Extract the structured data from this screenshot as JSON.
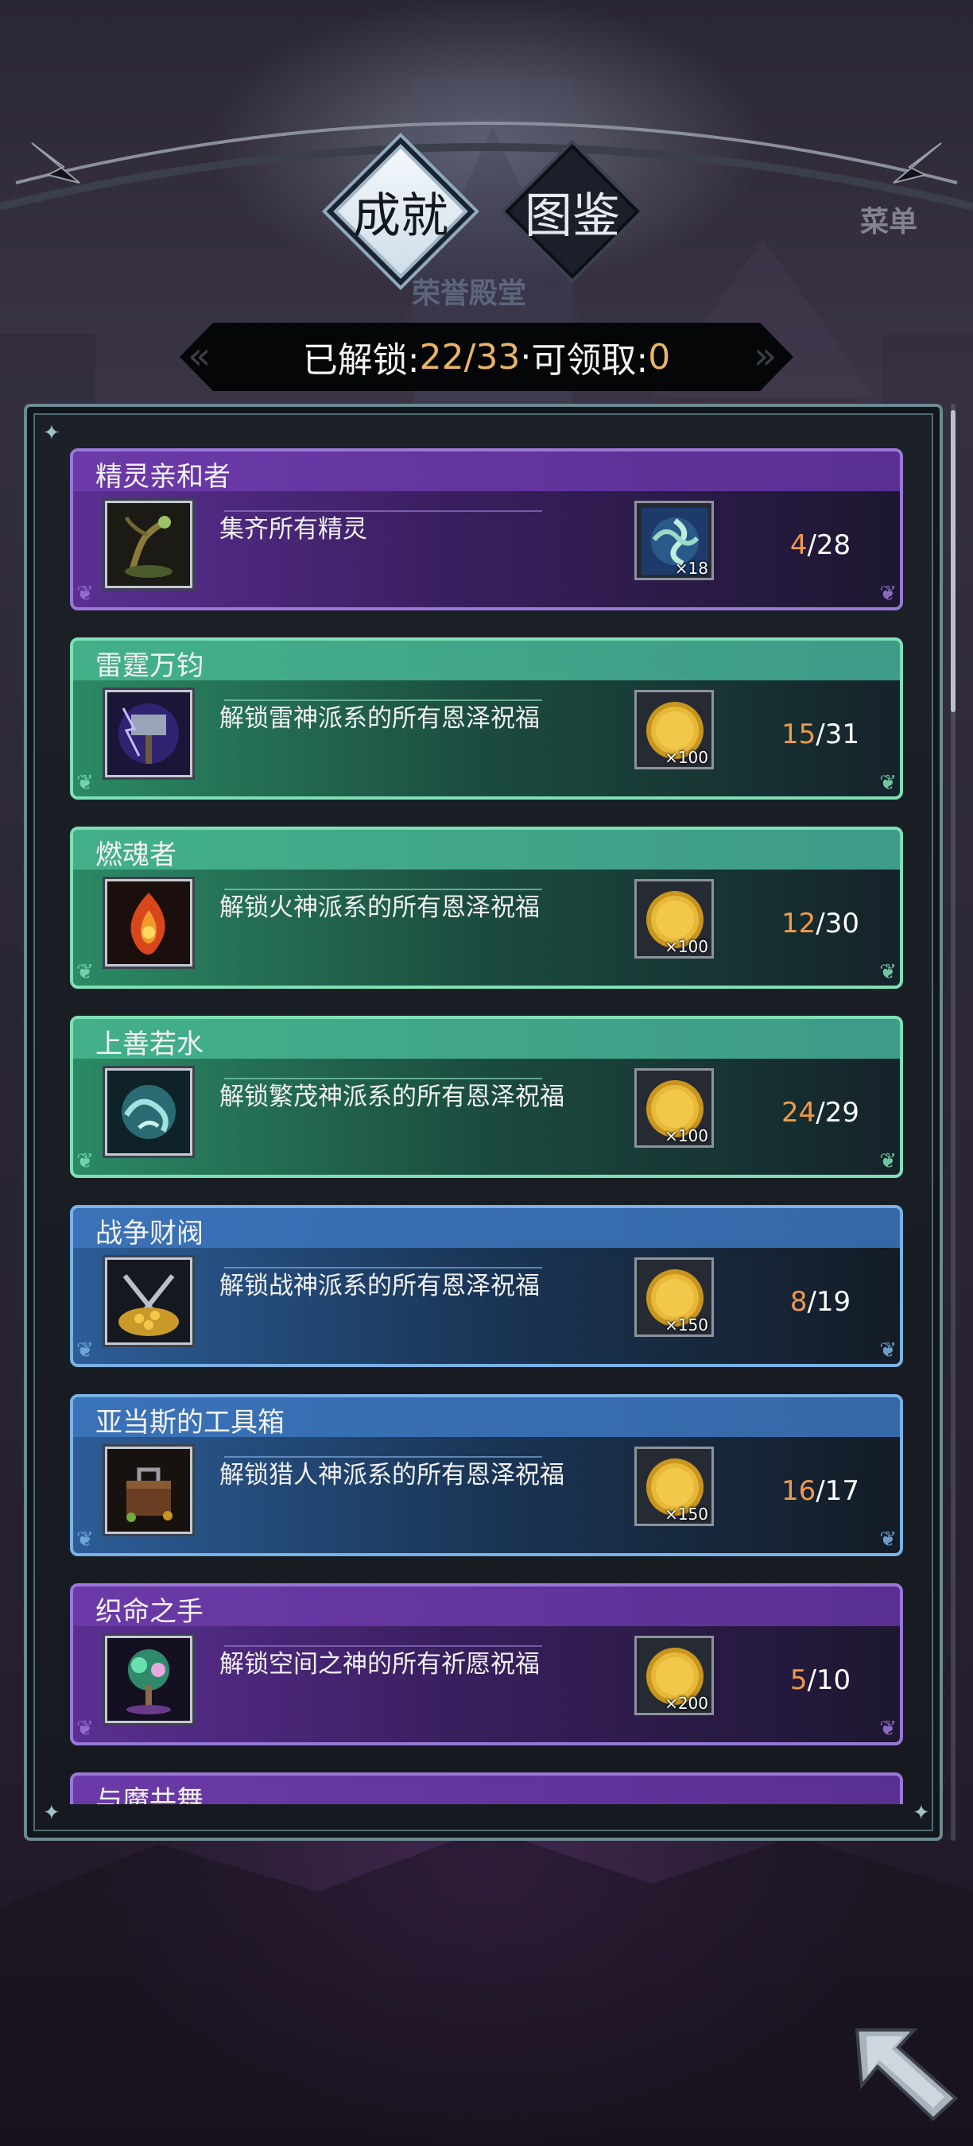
{
  "tabs": [
    {
      "label": "成就",
      "active": true
    },
    {
      "label": "图鉴",
      "active": false
    }
  ],
  "background": {
    "hall_label": "荣誉殿堂",
    "menu_label": "菜单"
  },
  "summary": {
    "unlocked_label": "已解锁:",
    "unlocked": "22",
    "separator": "/",
    "total": "33",
    "dot": " · ",
    "claimable_label": "可领取:",
    "claimable": "0"
  },
  "achievements": [
    {
      "title": "精灵亲和者",
      "desc": "集齐所有精灵",
      "theme": "purple",
      "icon": "nature-spirit-icon",
      "reward_icon": "spirit-orb-icon",
      "reward_qty": "×18",
      "current": "4",
      "slash": "/",
      "target": "28"
    },
    {
      "title": "雷霆万钧",
      "desc": "解锁雷神派系的所有恩泽祝福",
      "theme": "green",
      "icon": "thunder-hammer-icon",
      "reward_icon": "gold-coin-icon",
      "reward_qty": "×100",
      "current": "15",
      "slash": "/",
      "target": "31"
    },
    {
      "title": "燃魂者",
      "desc": "解锁火神派系的所有恩泽祝福",
      "theme": "green",
      "icon": "flame-soul-icon",
      "reward_icon": "gold-coin-icon",
      "reward_qty": "×100",
      "current": "12",
      "slash": "/",
      "target": "30"
    },
    {
      "title": "上善若水",
      "desc": "解锁繁茂神派系的所有恩泽祝福",
      "theme": "green",
      "icon": "water-spirit-icon",
      "reward_icon": "gold-coin-icon",
      "reward_qty": "×100",
      "current": "24",
      "slash": "/",
      "target": "29"
    },
    {
      "title": "战争财阀",
      "desc": "解锁战神派系的所有恩泽祝福",
      "theme": "blue",
      "icon": "treasure-swords-icon",
      "reward_icon": "gold-coin-icon",
      "reward_qty": "×150",
      "current": "8",
      "slash": "/",
      "target": "19"
    },
    {
      "title": "亚当斯的工具箱",
      "desc": "解锁猎人神派系的所有恩泽祝福",
      "theme": "blue",
      "icon": "toolbox-icon",
      "reward_icon": "gold-coin-icon",
      "reward_qty": "×150",
      "current": "16",
      "slash": "/",
      "target": "17"
    },
    {
      "title": "织命之手",
      "desc": "解锁空间之神的所有祈愿祝福",
      "theme": "purple",
      "icon": "fate-tree-icon",
      "reward_icon": "gold-coin-icon",
      "reward_qty": "×200",
      "current": "5",
      "slash": "/",
      "target": "10"
    },
    {
      "title": "与魔共舞",
      "desc": "",
      "theme": "purple",
      "icon": "",
      "reward_icon": "",
      "reward_qty": "",
      "current": "",
      "slash": "",
      "target": ""
    }
  ],
  "colors": {
    "progress_current": "#ee9a4c",
    "summary_numbers": "#e8b566",
    "purple_theme": "#9a78d8",
    "green_theme": "#7fe0b6",
    "blue_theme": "#79b2e6"
  }
}
